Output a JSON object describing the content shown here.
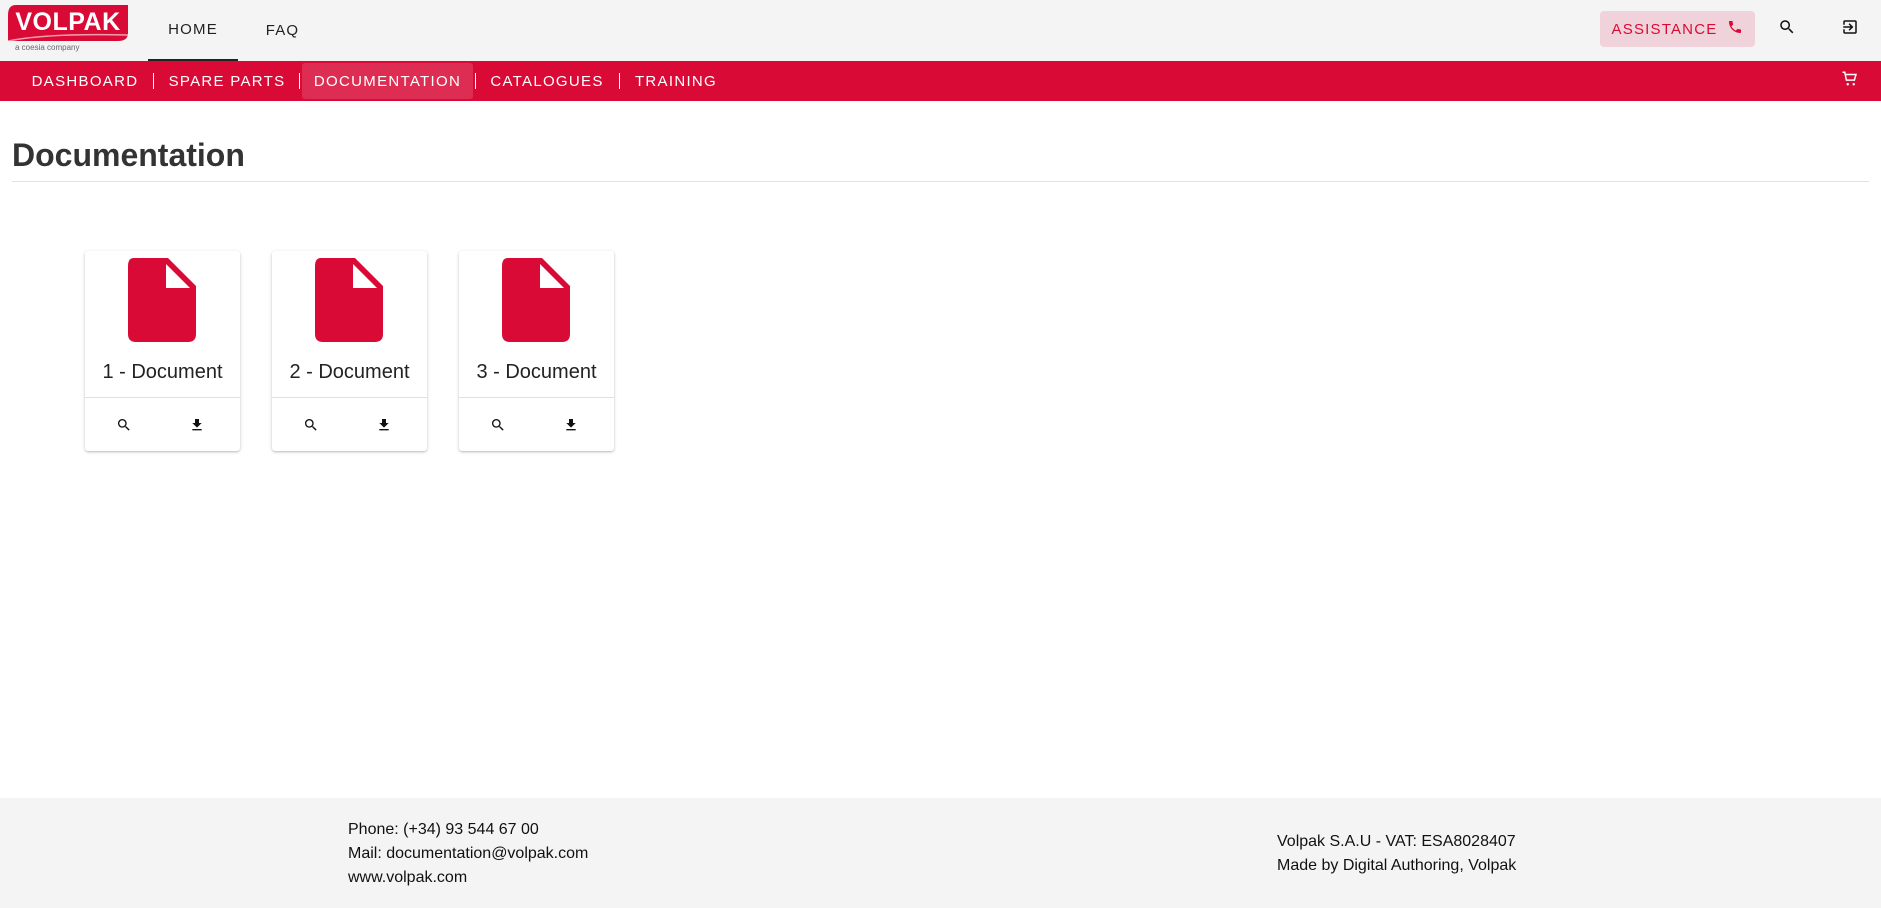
{
  "brand": {
    "name": "VOLPAK",
    "tagline": "a coesia company",
    "color": "#d90b36"
  },
  "top_nav": {
    "items": [
      {
        "label": "HOME",
        "active": true
      },
      {
        "label": "FAQ",
        "active": false
      }
    ],
    "assistance_label": "ASSISTANCE",
    "icons": [
      "phone-icon",
      "search-icon",
      "logout-icon"
    ]
  },
  "main_nav": {
    "items": [
      {
        "label": "DASHBOARD",
        "active": false
      },
      {
        "label": "SPARE PARTS",
        "active": false
      },
      {
        "label": "DOCUMENTATION",
        "active": true
      },
      {
        "label": "CATALOGUES",
        "active": false
      },
      {
        "label": "TRAINING",
        "active": false
      }
    ],
    "cart_icon": "cart-icon"
  },
  "page": {
    "title": "Documentation"
  },
  "documents": [
    {
      "title": "1 - Document",
      "icon": "file-icon",
      "actions": [
        "search-icon",
        "download-icon"
      ]
    },
    {
      "title": "2 - Document",
      "icon": "file-icon",
      "actions": [
        "search-icon",
        "download-icon"
      ]
    },
    {
      "title": "3 - Document",
      "icon": "file-icon",
      "actions": [
        "search-icon",
        "download-icon"
      ]
    }
  ],
  "footer": {
    "phone": "Phone: (+34) 93 544 67 00",
    "mail": "Mail: documentation@volpak.com",
    "website": "www.volpak.com",
    "company": "Volpak S.A.U - VAT: ESA8028407",
    "credits": "Made by Digital Authoring, Volpak"
  }
}
